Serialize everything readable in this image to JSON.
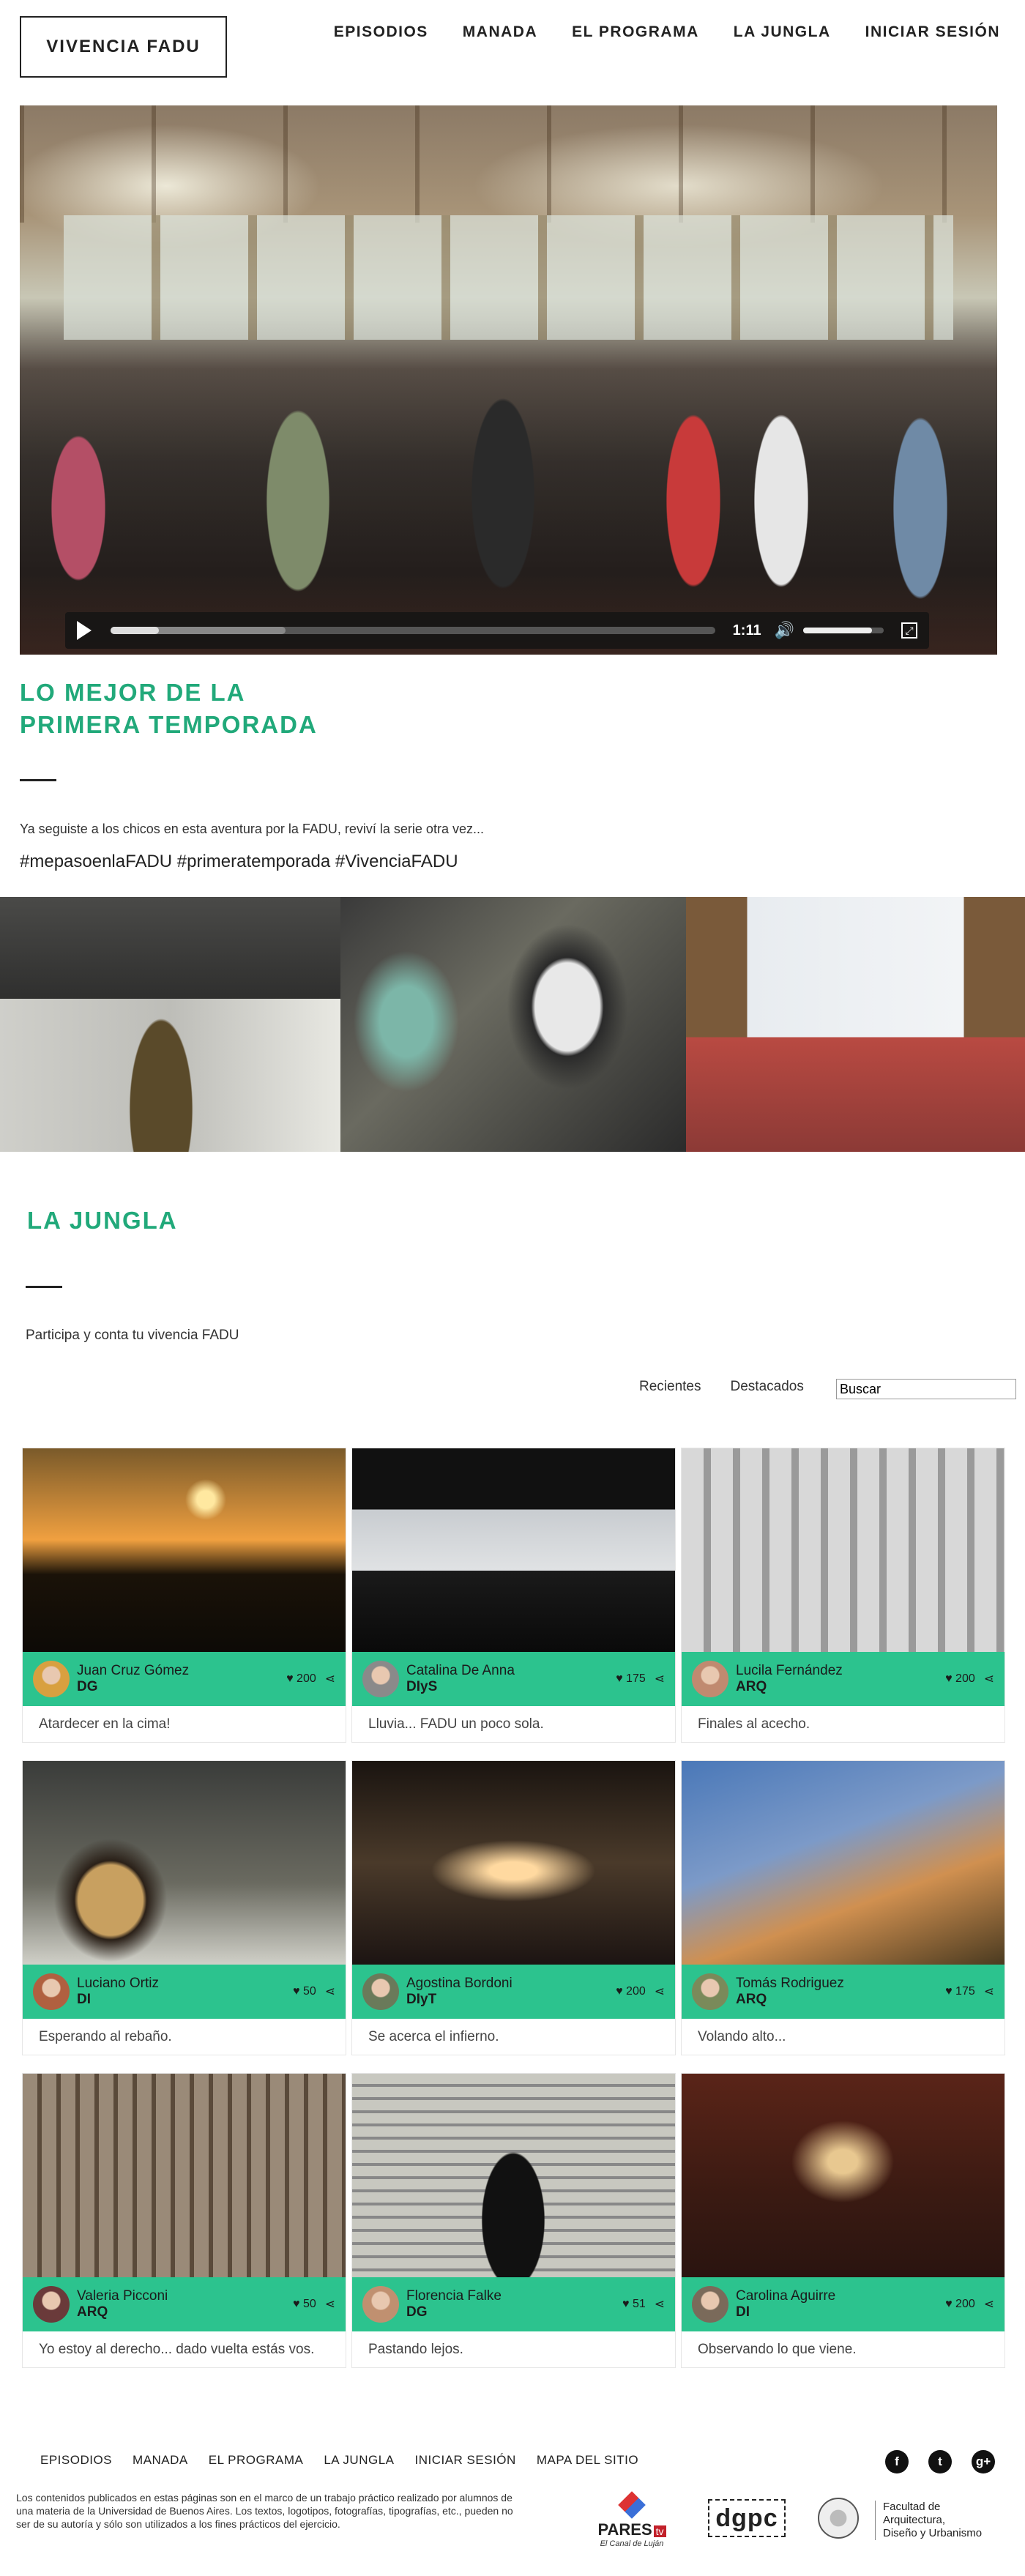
{
  "header": {
    "logo": "VIVENCIA FADU",
    "nav": [
      "EPISODIOS",
      "MANADA",
      "EL PROGRAMA",
      "LA JUNGLA",
      "INICIAR SESIÓN"
    ]
  },
  "player": {
    "time": "1:11",
    "progress": 0.08,
    "buffered": 0.29,
    "volume": 0.85
  },
  "intro": {
    "title_line1": "LO MEJOR DE LA",
    "title_line2": "PRIMERA TEMPORADA",
    "text": "Ya seguiste a los chicos en esta aventura por la FADU, reviví la serie otra vez...",
    "hashtags": "#mepasoenlaFADU #primeratemporada #VivenciaFADU"
  },
  "jungla": {
    "title": "LA JUNGLA",
    "text": "Participa y conta tu vivencia FADU",
    "filters": [
      "Recientes",
      "Destacados"
    ],
    "search_value": "Buscar"
  },
  "cards": [
    {
      "name": "Juan Cruz Gómez",
      "dept": "DG",
      "likes": "200",
      "caption": "Atardecer en la cima!"
    },
    {
      "name": "Catalina De Anna",
      "dept": "DIyS",
      "likes": "175",
      "caption": "Lluvia... FADU un poco sola."
    },
    {
      "name": "Lucila Fernández",
      "dept": "ARQ",
      "likes": "200",
      "caption": "Finales al acecho."
    },
    {
      "name": "Luciano Ortiz",
      "dept": "DI",
      "likes": "50",
      "caption": "Esperando al rebaño."
    },
    {
      "name": "Agostina Bordoni",
      "dept": "DIyT",
      "likes": "200",
      "caption": "Se acerca el infierno."
    },
    {
      "name": "Tomás Rodriguez",
      "dept": "ARQ",
      "likes": "175",
      "caption": "Volando alto..."
    },
    {
      "name": "Valeria Picconi",
      "dept": "ARQ",
      "likes": "50",
      "caption": "Yo estoy al derecho... dado vuelta estás vos."
    },
    {
      "name": "Florencia Falke",
      "dept": "DG",
      "likes": "51",
      "caption": "Pastando lejos."
    },
    {
      "name": "Carolina Aguirre",
      "dept": "DI",
      "likes": "200",
      "caption": "Observando lo que viene."
    }
  ],
  "footer": {
    "nav": [
      "EPISODIOS",
      "MANADA",
      "EL PROGRAMA",
      "LA JUNGLA",
      "INICIAR SESIÓN",
      "MAPA DEL SITIO"
    ],
    "social": [
      "facebook-icon",
      "twitter-icon",
      "google-plus-icon"
    ],
    "disclaimer": "Los contenidos publicados en estas páginas son en el marco de un trabajo práctico realizado por alumnos de una materia de la Universidad de Buenos Aires. Los textos, logotipos, fotografías, tipografías, etc., pueden no ser de su autoría y sólo son utilizados a los fines prácticos del ejercicio.",
    "pares_name": "PARES",
    "pares_tv": "tv",
    "pares_sub": "El Canal de Luján",
    "dgpc": "dgpc",
    "fadu_line1": "Facultad de",
    "fadu_line2": "Arquitectura,",
    "fadu_line3": "Diseño y Urbanismo"
  },
  "colors": {
    "accent": "#21a97a",
    "card_bar": "#2cc38e"
  }
}
